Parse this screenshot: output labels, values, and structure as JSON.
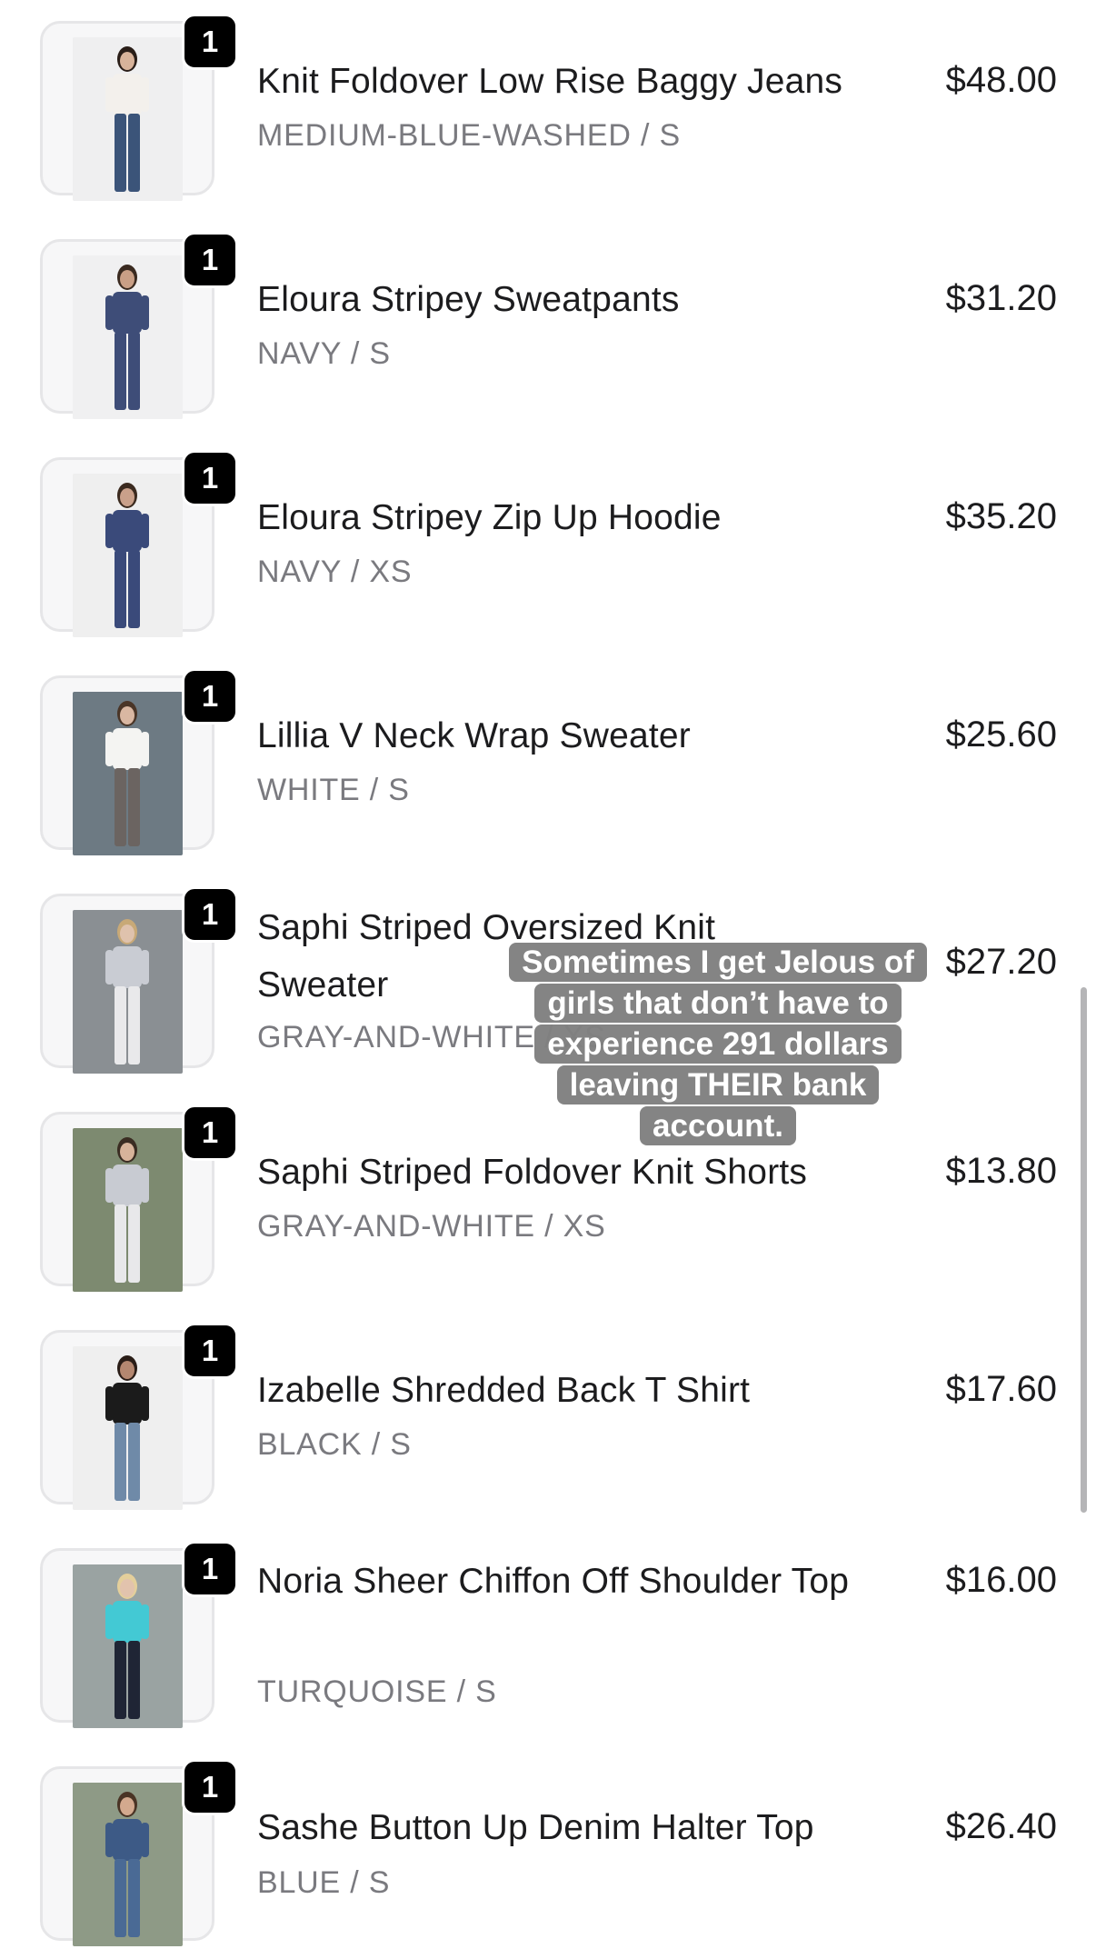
{
  "cart": {
    "items": [
      {
        "qty": "1",
        "name": "Knit Foldover Low Rise Baggy Jeans",
        "variant": "MEDIUM-BLUE-WASHED / S",
        "price": "$48.00",
        "colors": {
          "bg": "#efeff0",
          "top": "#f3f0ec",
          "bottom": "#3b5479",
          "skin": "#d8b39a",
          "hair": "#2a1e18"
        }
      },
      {
        "qty": "1",
        "name": "Eloura Stripey Sweatpants",
        "variant": "NAVY / S",
        "price": "$31.20",
        "colors": {
          "bg": "#f0f0f1",
          "top": "#3e4d78",
          "bottom": "#3e4d78",
          "skin": "#c99f86",
          "hair": "#3a2a20"
        }
      },
      {
        "qty": "1",
        "name": "Eloura Stripey Zip Up Hoodie",
        "variant": "NAVY / XS",
        "price": "$35.20",
        "colors": {
          "bg": "#efefef",
          "top": "#3a4a7a",
          "bottom": "#3a4a7a",
          "skin": "#c9a08a",
          "hair": "#3b2a1f"
        }
      },
      {
        "qty": "1",
        "name": "Lillia V Neck Wrap Sweater",
        "variant": "WHITE / S",
        "price": "$25.60",
        "colors": {
          "bg": "#6d7a83",
          "top": "#f4f4f2",
          "bottom": "#6b6461",
          "skin": "#d9b7a2",
          "hair": "#4a3527"
        }
      },
      {
        "qty": "1",
        "name": "Saphi Striped Oversized Knit Sweater",
        "variant": "GRAY-AND-WHITE / XS",
        "price": "$27.20",
        "colors": {
          "bg": "#8a8f93",
          "top": "#c9ccd3",
          "bottom": "#e9e9eb",
          "skin": "#dfc2ad",
          "hair": "#c8a977"
        }
      },
      {
        "qty": "1",
        "name": "Saphi Striped Foldover Knit Shorts",
        "variant": "GRAY-AND-WHITE / XS",
        "price": "$13.80",
        "colors": {
          "bg": "#7d8a70",
          "top": "#c8cbd2",
          "bottom": "#e8e8ea",
          "skin": "#d7b39a",
          "hair": "#3a2c22"
        }
      },
      {
        "qty": "1",
        "name": "Izabelle Shredded Back T Shirt",
        "variant": "BLACK / S",
        "price": "$17.60",
        "colors": {
          "bg": "#efefef",
          "top": "#1b1b1b",
          "bottom": "#6f8aa8",
          "skin": "#b48770",
          "hair": "#2a1d17"
        }
      },
      {
        "qty": "1",
        "name": "Noria Sheer Chiffon Off Shoulder Top",
        "variant": "TURQUOISE / S",
        "price": "$16.00",
        "colors": {
          "bg": "#9aa3a2",
          "top": "#43c9d4",
          "bottom": "#1f2535",
          "skin": "#e2c3ad",
          "hair": "#e4cf9b"
        }
      },
      {
        "qty": "1",
        "name": "Sashe Button Up Denim Halter Top",
        "variant": "BLUE / S",
        "price": "$26.40",
        "colors": {
          "bg": "#8e9a86",
          "top": "#3d5a86",
          "bottom": "#4a6a95",
          "skin": "#d3a98e",
          "hair": "#4a3425"
        }
      }
    ]
  },
  "overlay": {
    "caption_lines": [
      "Sometimes I get Jelous of",
      "girls that don’t have to",
      "experience 291 dollars",
      "leaving THEIR bank",
      "account."
    ]
  }
}
